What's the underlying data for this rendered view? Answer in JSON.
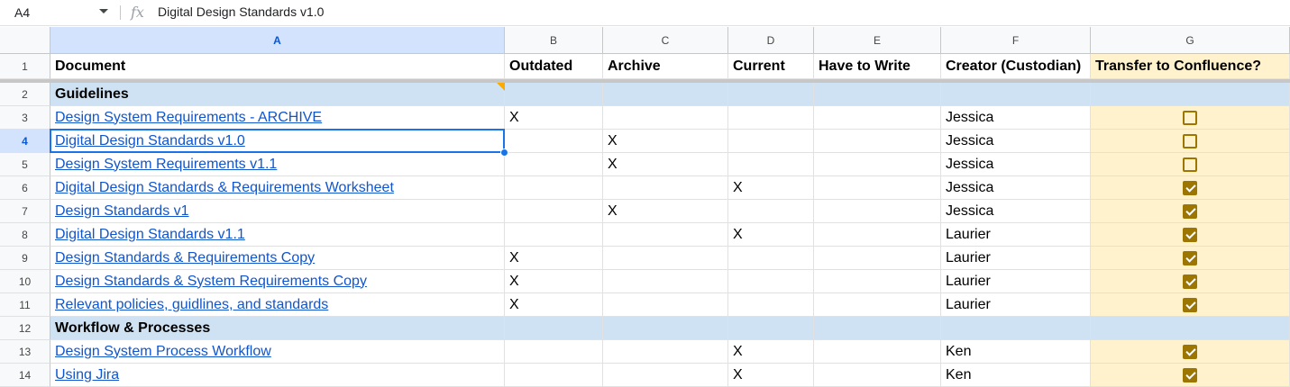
{
  "formula_bar": {
    "name_box": "A4",
    "fx_label": "fx",
    "formula": "Digital Design Standards v1.0"
  },
  "columns": [
    "A",
    "B",
    "C",
    "D",
    "E",
    "F",
    "G"
  ],
  "selected_column": "A",
  "selected_row": 4,
  "header_row": {
    "row": 1,
    "cells": [
      "Document",
      "Outdated",
      "Archive",
      "Current",
      "Have to Write",
      "Creator (Custodian)",
      "Transfer to Confluence?"
    ]
  },
  "rows": [
    {
      "row": 2,
      "type": "section",
      "label": "Guidelines"
    },
    {
      "row": 3,
      "doc": "Design System Requirements - ARCHIVE",
      "outdated": "X",
      "archive": "",
      "current": "",
      "have_to_write": "",
      "creator": "Jessica",
      "transfer": false
    },
    {
      "row": 4,
      "doc": "Digital Design Standards v1.0",
      "outdated": "",
      "archive": "X",
      "current": "",
      "have_to_write": "",
      "creator": "Jessica",
      "transfer": false
    },
    {
      "row": 5,
      "doc": "Design System Requirements v1.1",
      "outdated": "",
      "archive": "X",
      "current": "",
      "have_to_write": "",
      "creator": "Jessica",
      "transfer": false
    },
    {
      "row": 6,
      "doc": "Digital Design Standards & Requirements Worksheet",
      "outdated": "",
      "archive": "",
      "current": "X",
      "have_to_write": "",
      "creator": "Jessica",
      "transfer": true
    },
    {
      "row": 7,
      "doc": "Design Standards v1",
      "outdated": "",
      "archive": "X",
      "current": "",
      "have_to_write": "",
      "creator": "Jessica",
      "transfer": true
    },
    {
      "row": 8,
      "doc": "Digital Design Standards v1.1",
      "outdated": "",
      "archive": "",
      "current": "X",
      "have_to_write": "",
      "creator": "Laurier",
      "transfer": true
    },
    {
      "row": 9,
      "doc": "Design Standards & Requirements Copy",
      "outdated": "X",
      "archive": "",
      "current": "",
      "have_to_write": "",
      "creator": "Laurier",
      "transfer": true
    },
    {
      "row": 10,
      "doc": "Design Standards & System Requirements Copy",
      "outdated": "X",
      "archive": "",
      "current": "",
      "have_to_write": "",
      "creator": "Laurier",
      "transfer": true
    },
    {
      "row": 11,
      "doc": "Relevant policies, guidlines, and standards",
      "outdated": "X",
      "archive": "",
      "current": "",
      "have_to_write": "",
      "creator": "Laurier",
      "transfer": true
    },
    {
      "row": 12,
      "type": "section",
      "label": "Workflow & Processes"
    },
    {
      "row": 13,
      "doc": "Design System Process Workflow",
      "outdated": "",
      "archive": "",
      "current": "X",
      "have_to_write": "",
      "creator": "Ken",
      "transfer": true
    },
    {
      "row": 14,
      "doc": "Using Jira",
      "outdated": "",
      "archive": "",
      "current": "X",
      "have_to_write": "",
      "creator": "Ken",
      "transfer": true
    }
  ],
  "colors": {
    "section_fill": "#cfe2f3",
    "transfer_column_fill": "#fff2cc",
    "checkbox_color": "#9c7600",
    "link_color": "#1155cc",
    "selection_color": "#1a73e8"
  }
}
